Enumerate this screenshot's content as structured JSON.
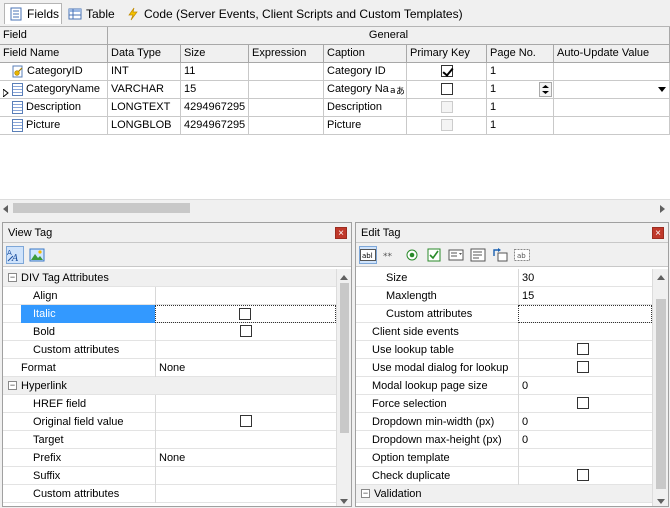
{
  "tabs": [
    {
      "label": "Fields",
      "icon": "fields-icon"
    },
    {
      "label": "Table",
      "icon": "table-icon"
    },
    {
      "label": "Code (Server Events, Client Scripts and Custom Templates)",
      "icon": "lightning-icon"
    }
  ],
  "grid": {
    "group_headers": {
      "field": "Field",
      "general": "General"
    },
    "columns": [
      "Field Name",
      "Data Type",
      "Size",
      "Expression",
      "Caption",
      "Primary Key",
      "Page No.",
      "Auto-Update Value"
    ],
    "rows": [
      {
        "name": "CategoryID",
        "type": "INT",
        "size": "11",
        "expression": "",
        "caption": "Category ID",
        "pk": true,
        "pk_disabled": false,
        "page": "1",
        "auto": "",
        "icon": "key-field-icon",
        "current": false
      },
      {
        "name": "CategoryName",
        "type": "VARCHAR",
        "size": "15",
        "expression": "",
        "caption": "Category Na",
        "pk": false,
        "pk_disabled": false,
        "page": "1",
        "auto": "",
        "icon": "field-icon",
        "current": true
      },
      {
        "name": "Description",
        "type": "LONGTEXT",
        "size": "4294967295",
        "expression": "",
        "caption": "Description",
        "pk": false,
        "pk_disabled": true,
        "page": "1",
        "auto": "",
        "icon": "field-icon",
        "current": false
      },
      {
        "name": "Picture",
        "type": "LONGBLOB",
        "size": "4294967295",
        "expression": "",
        "caption": "Picture",
        "pk": false,
        "pk_disabled": true,
        "page": "1",
        "auto": "",
        "icon": "field-icon",
        "current": false
      }
    ]
  },
  "view_tag": {
    "title": "View Tag",
    "close": "×",
    "rows": [
      {
        "kind": "cat",
        "label": "DIV Tag Attributes",
        "expand": "−"
      },
      {
        "kind": "prop",
        "label": "Align",
        "value": ""
      },
      {
        "kind": "prop",
        "label": "Italic",
        "value": "",
        "check": false,
        "selected": true
      },
      {
        "kind": "prop",
        "label": "Bold",
        "value": "",
        "check": false
      },
      {
        "kind": "prop",
        "label": "Custom attributes",
        "value": ""
      },
      {
        "kind": "top",
        "label": "Format",
        "value": "None"
      },
      {
        "kind": "cat",
        "label": "Hyperlink",
        "expand": "−"
      },
      {
        "kind": "prop",
        "label": "HREF field",
        "value": ""
      },
      {
        "kind": "prop",
        "label": "Original field value",
        "value": "",
        "check": false
      },
      {
        "kind": "prop",
        "label": "Target",
        "value": ""
      },
      {
        "kind": "prop",
        "label": "Prefix",
        "value": "None"
      },
      {
        "kind": "prop",
        "label": "Suffix",
        "value": ""
      },
      {
        "kind": "prop",
        "label": "Custom attributes",
        "value": ""
      }
    ]
  },
  "edit_tag": {
    "title": "Edit Tag",
    "close": "×",
    "rows": [
      {
        "kind": "prop",
        "label": "Size",
        "value": "30"
      },
      {
        "kind": "prop",
        "label": "Maxlength",
        "value": "15"
      },
      {
        "kind": "prop",
        "label": "Custom attributes",
        "value": "",
        "editing": true
      },
      {
        "kind": "top",
        "label": "Client side events",
        "value": ""
      },
      {
        "kind": "top",
        "label": "Use lookup table",
        "value": "",
        "check": false
      },
      {
        "kind": "top",
        "label": "Use modal dialog for lookup",
        "value": "",
        "check": false
      },
      {
        "kind": "top",
        "label": "Modal lookup page size",
        "value": "0"
      },
      {
        "kind": "top",
        "label": "Force selection",
        "value": "",
        "check": false
      },
      {
        "kind": "top",
        "label": "Dropdown min-width (px)",
        "value": "0"
      },
      {
        "kind": "top",
        "label": "Dropdown max-height (px)",
        "value": "0"
      },
      {
        "kind": "top",
        "label": "Option template",
        "value": ""
      },
      {
        "kind": "top",
        "label": "Check duplicate",
        "value": "",
        "check": false
      },
      {
        "kind": "cat",
        "label": "Validation",
        "expand": "−"
      }
    ]
  }
}
